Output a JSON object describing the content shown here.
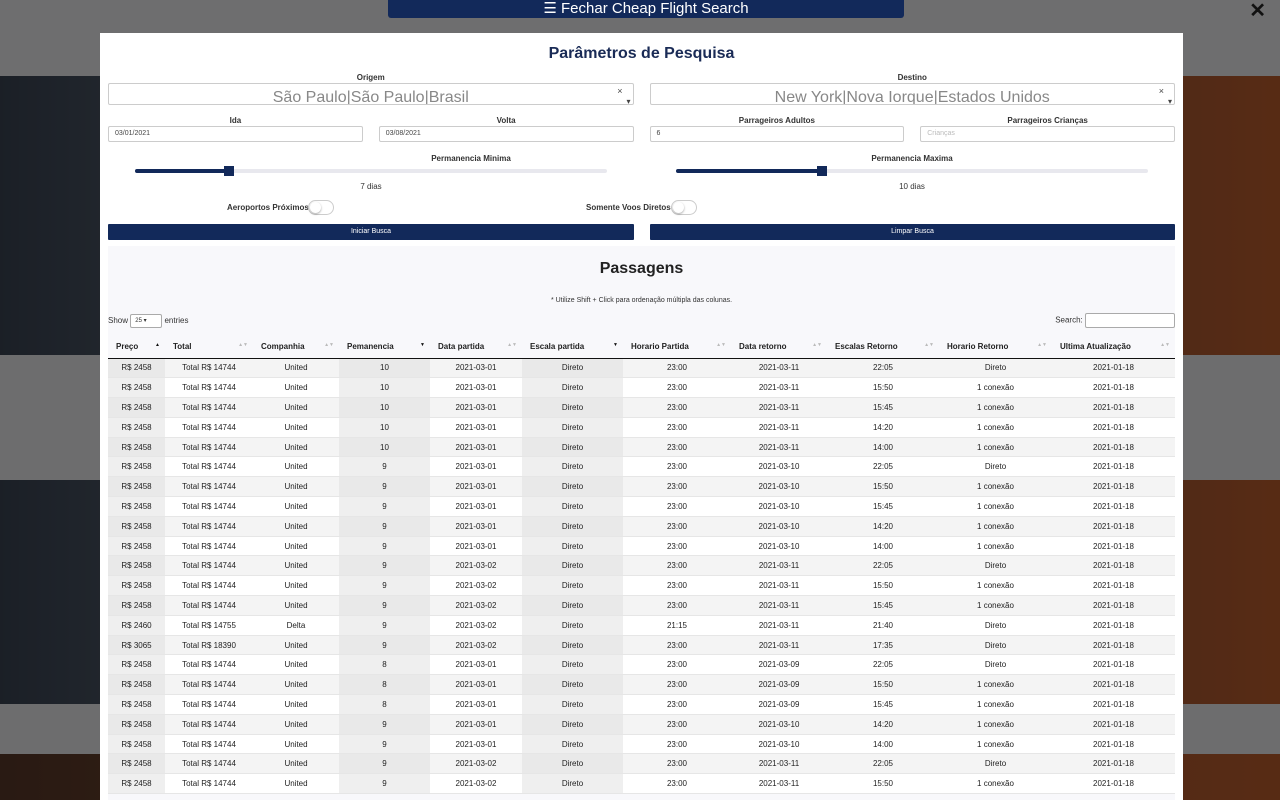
{
  "topbar": {
    "label": "☰ Fechar Cheap Flight Search",
    "close": "✕"
  },
  "modal": {
    "title": "Parâmetros de Pesquisa",
    "origem": {
      "label": "Origem",
      "value": "São Paulo|São Paulo|Brasil"
    },
    "destino": {
      "label": "Destino",
      "value": "New York|Nova Iorque|Estados Unidos"
    },
    "ida": {
      "label": "Ida",
      "value": "03/01/2021"
    },
    "volta": {
      "label": "Volta",
      "value": "03/08/2021"
    },
    "adultos": {
      "label": "Parrageiros Adultos",
      "value": "6"
    },
    "criancas": {
      "label": "Parrageiros Crianças",
      "placeholder": "Crianças"
    },
    "perm_min": {
      "label": "Permanencia Minima",
      "value": "7 dias",
      "level": 0.2
    },
    "perm_max": {
      "label": "Permanencia Maxima",
      "value": "10 dias",
      "level": 0.31
    },
    "aeroportos": {
      "label": "Aeroportos Próximos",
      "on": false
    },
    "diretos": {
      "label": "Somente Voos Diretos",
      "on": false
    },
    "iniciar": "Iniciar Busca",
    "limpar": "Limpar Busca"
  },
  "results": {
    "title": "Passagens",
    "hint": "* Utilize Shift + Click para ordenação múltipla das colunas.",
    "show_label": "Show",
    "entries_value": "25",
    "entries_label": "entries",
    "search_label": "Search:",
    "columns": [
      "Preço",
      "Total",
      "Companhia",
      "Pemanencia",
      "Data partida",
      "Escala partida",
      "Horario Partida",
      "Data retorno",
      "Escalas Retorno",
      "Horario Retorno",
      "Ultima Atualização"
    ],
    "rows": [
      [
        "R$ 2458",
        "Total R$ 14744",
        "United",
        "10",
        "2021-03-01",
        "Direto",
        "23:00",
        "2021-03-11",
        "22:05",
        "Direto",
        "2021-01-18"
      ],
      [
        "R$ 2458",
        "Total R$ 14744",
        "United",
        "10",
        "2021-03-01",
        "Direto",
        "23:00",
        "2021-03-11",
        "15:50",
        "1 conexão",
        "2021-01-18"
      ],
      [
        "R$ 2458",
        "Total R$ 14744",
        "United",
        "10",
        "2021-03-01",
        "Direto",
        "23:00",
        "2021-03-11",
        "15:45",
        "1 conexão",
        "2021-01-18"
      ],
      [
        "R$ 2458",
        "Total R$ 14744",
        "United",
        "10",
        "2021-03-01",
        "Direto",
        "23:00",
        "2021-03-11",
        "14:20",
        "1 conexão",
        "2021-01-18"
      ],
      [
        "R$ 2458",
        "Total R$ 14744",
        "United",
        "10",
        "2021-03-01",
        "Direto",
        "23:00",
        "2021-03-11",
        "14:00",
        "1 conexão",
        "2021-01-18"
      ],
      [
        "R$ 2458",
        "Total R$ 14744",
        "United",
        "9",
        "2021-03-01",
        "Direto",
        "23:00",
        "2021-03-10",
        "22:05",
        "Direto",
        "2021-01-18"
      ],
      [
        "R$ 2458",
        "Total R$ 14744",
        "United",
        "9",
        "2021-03-01",
        "Direto",
        "23:00",
        "2021-03-10",
        "15:50",
        "1 conexão",
        "2021-01-18"
      ],
      [
        "R$ 2458",
        "Total R$ 14744",
        "United",
        "9",
        "2021-03-01",
        "Direto",
        "23:00",
        "2021-03-10",
        "15:45",
        "1 conexão",
        "2021-01-18"
      ],
      [
        "R$ 2458",
        "Total R$ 14744",
        "United",
        "9",
        "2021-03-01",
        "Direto",
        "23:00",
        "2021-03-10",
        "14:20",
        "1 conexão",
        "2021-01-18"
      ],
      [
        "R$ 2458",
        "Total R$ 14744",
        "United",
        "9",
        "2021-03-01",
        "Direto",
        "23:00",
        "2021-03-10",
        "14:00",
        "1 conexão",
        "2021-01-18"
      ],
      [
        "R$ 2458",
        "Total R$ 14744",
        "United",
        "9",
        "2021-03-02",
        "Direto",
        "23:00",
        "2021-03-11",
        "22:05",
        "Direto",
        "2021-01-18"
      ],
      [
        "R$ 2458",
        "Total R$ 14744",
        "United",
        "9",
        "2021-03-02",
        "Direto",
        "23:00",
        "2021-03-11",
        "15:50",
        "1 conexão",
        "2021-01-18"
      ],
      [
        "R$ 2458",
        "Total R$ 14744",
        "United",
        "9",
        "2021-03-02",
        "Direto",
        "23:00",
        "2021-03-11",
        "15:45",
        "1 conexão",
        "2021-01-18"
      ],
      [
        "R$ 2460",
        "Total R$ 14755",
        "Delta",
        "9",
        "2021-03-02",
        "Direto",
        "21:15",
        "2021-03-11",
        "21:40",
        "Direto",
        "2021-01-18"
      ],
      [
        "R$ 3065",
        "Total R$ 18390",
        "United",
        "9",
        "2021-03-02",
        "Direto",
        "23:00",
        "2021-03-11",
        "17:35",
        "Direto",
        "2021-01-18"
      ],
      [
        "R$ 2458",
        "Total R$ 14744",
        "United",
        "8",
        "2021-03-01",
        "Direto",
        "23:00",
        "2021-03-09",
        "22:05",
        "Direto",
        "2021-01-18"
      ],
      [
        "R$ 2458",
        "Total R$ 14744",
        "United",
        "8",
        "2021-03-01",
        "Direto",
        "23:00",
        "2021-03-09",
        "15:50",
        "1 conexão",
        "2021-01-18"
      ],
      [
        "R$ 2458",
        "Total R$ 14744",
        "United",
        "8",
        "2021-03-01",
        "Direto",
        "23:00",
        "2021-03-09",
        "15:45",
        "1 conexão",
        "2021-01-18"
      ],
      [
        "R$ 2458",
        "Total R$ 14744",
        "United",
        "9",
        "2021-03-01",
        "Direto",
        "23:00",
        "2021-03-10",
        "14:20",
        "1 conexão",
        "2021-01-18"
      ],
      [
        "R$ 2458",
        "Total R$ 14744",
        "United",
        "9",
        "2021-03-01",
        "Direto",
        "23:00",
        "2021-03-10",
        "14:00",
        "1 conexão",
        "2021-01-18"
      ],
      [
        "R$ 2458",
        "Total R$ 14744",
        "United",
        "9",
        "2021-03-02",
        "Direto",
        "23:00",
        "2021-03-11",
        "22:05",
        "Direto",
        "2021-01-18"
      ],
      [
        "R$ 2458",
        "Total R$ 14744",
        "United",
        "9",
        "2021-03-02",
        "Direto",
        "23:00",
        "2021-03-11",
        "15:50",
        "1 conexão",
        "2021-01-18"
      ]
    ]
  },
  "colors": {
    "primary": "#12295a"
  }
}
